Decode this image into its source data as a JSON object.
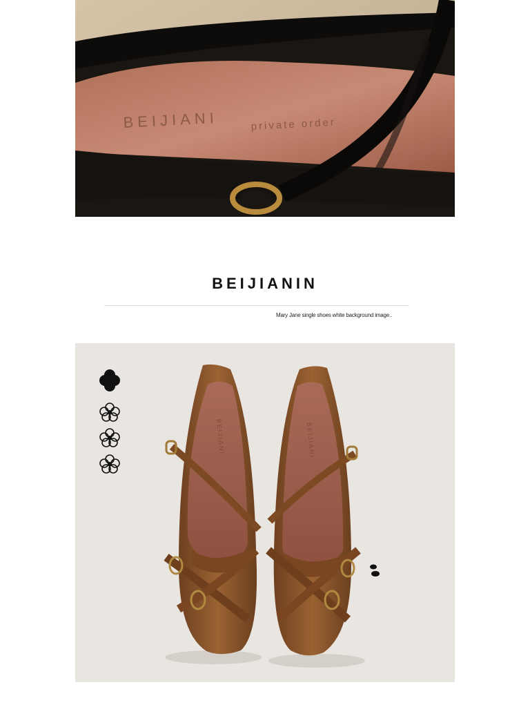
{
  "top_image": {
    "insole_print": "BEIJIANI",
    "insole_print_secondary": "private order"
  },
  "brand": {
    "title": "BEIJIANIN",
    "caption": "Mary Jane single shoes white background image.."
  },
  "product_image": {
    "insole_print_left": "BEIJIANI",
    "insole_print_right": "BEIJIANI"
  },
  "colors": {
    "page_bg": "#ffffff",
    "product_bg": "#e9e5e1",
    "leather_brown": "#8a5428",
    "insole_pink": "#a66650",
    "strap_black": "#111111"
  }
}
